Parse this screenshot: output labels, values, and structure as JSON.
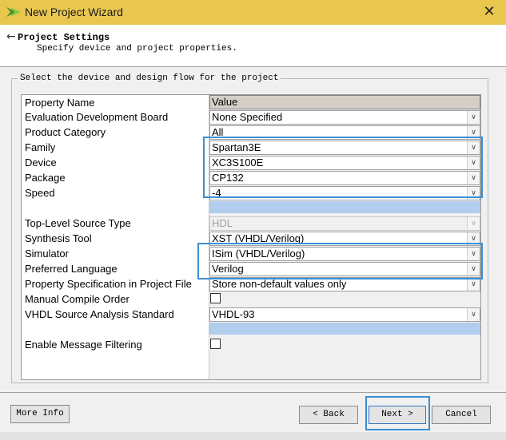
{
  "window": {
    "title": "New Project Wizard",
    "close_glyph": "✕"
  },
  "header": {
    "back_glyph": "←",
    "title": "Project Settings",
    "subtitle": "Specify device and project properties."
  },
  "group": {
    "label": "Select the device and design flow for the project"
  },
  "table": {
    "col_property": "Property Name",
    "col_value": "Value",
    "rows": {
      "eval_board": {
        "label": "Evaluation Development Board",
        "value": "None Specified"
      },
      "product_category": {
        "label": "Product Category",
        "value": "All"
      },
      "family": {
        "label": "Family",
        "value": "Spartan3E"
      },
      "device": {
        "label": "Device",
        "value": "XC3S100E"
      },
      "package": {
        "label": "Package",
        "value": "CP132"
      },
      "speed": {
        "label": "Speed",
        "value": "-4"
      },
      "top_level_source": {
        "label": "Top-Level Source Type",
        "value": "HDL"
      },
      "synthesis_tool": {
        "label": "Synthesis Tool",
        "value": "XST (VHDL/Verilog)"
      },
      "simulator": {
        "label": "Simulator",
        "value": "ISim (VHDL/Verilog)"
      },
      "preferred_language": {
        "label": "Preferred Language",
        "value": "Verilog"
      },
      "prop_spec": {
        "label": "Property Specification in Project File",
        "value": "Store non-default values only"
      },
      "manual_compile": {
        "label": "Manual Compile Order"
      },
      "vhdl_standard": {
        "label": "VHDL Source Analysis Standard",
        "value": "VHDL-93"
      },
      "message_filtering": {
        "label": "Enable Message Filtering"
      }
    },
    "dropdown_glyph": "∨"
  },
  "footer": {
    "more_info": "More Info",
    "back": "< Back",
    "next": "Next >",
    "cancel": "Cancel"
  },
  "colors": {
    "titlebar": "#e9c74f",
    "highlight_box": "#3b8fd4",
    "selection_strip": "#b3cdef"
  }
}
